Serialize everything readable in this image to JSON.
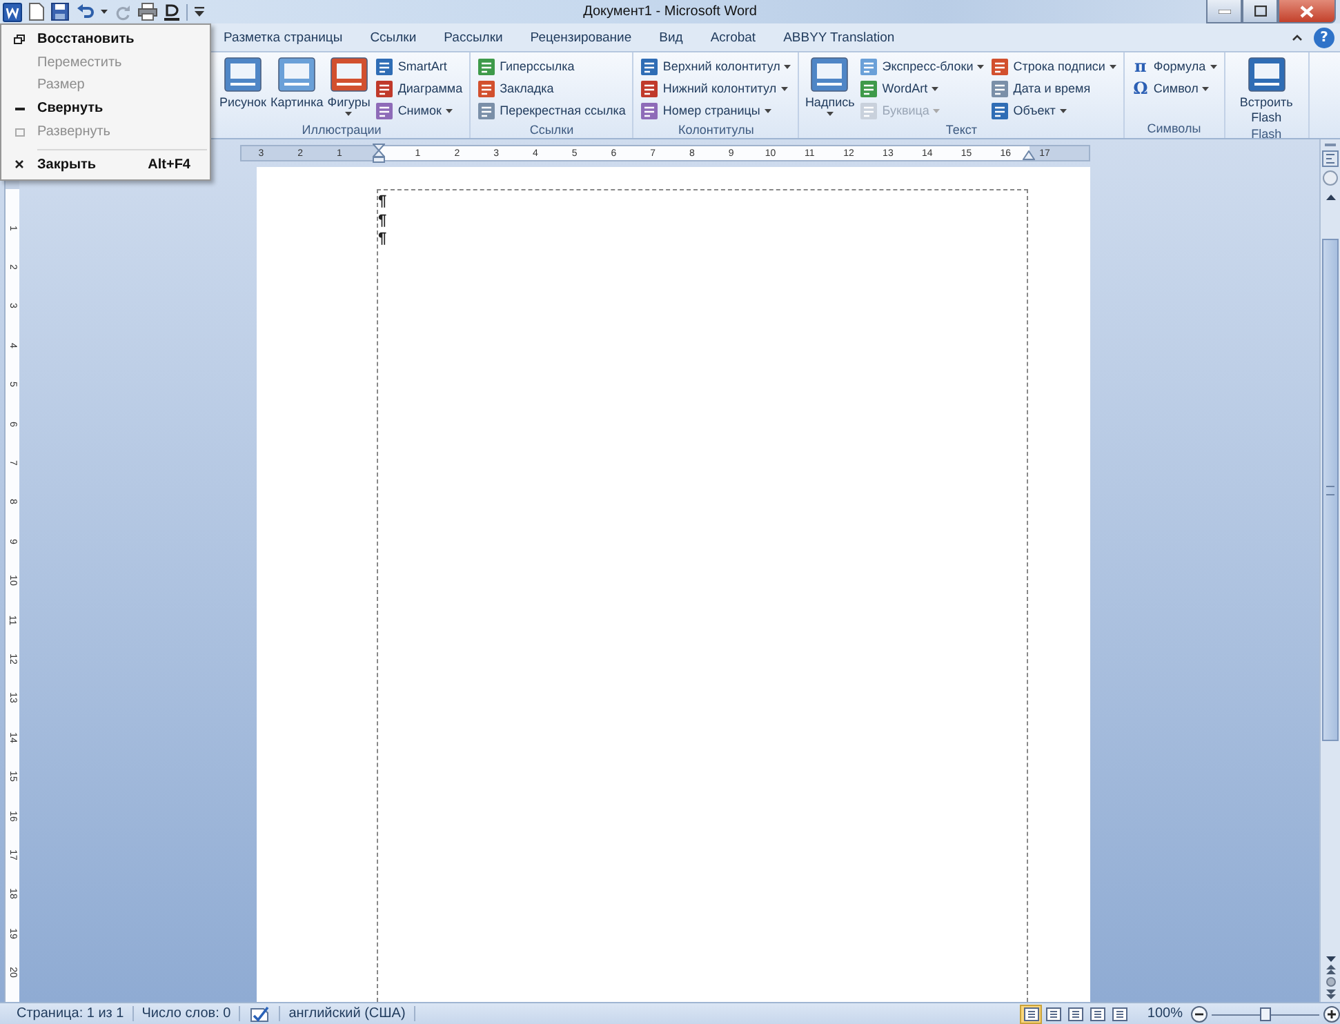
{
  "title_bar": {
    "title": "Документ1 - Microsoft Word"
  },
  "system_menu": {
    "items": [
      {
        "label": "Восстановить",
        "kind": "restore",
        "disabled": false,
        "separator_before": false
      },
      {
        "label": "Переместить",
        "kind": "move",
        "disabled": true,
        "separator_before": false
      },
      {
        "label": "Размер",
        "kind": "size",
        "disabled": true,
        "separator_before": false
      },
      {
        "label": "Свернуть",
        "kind": "minimize",
        "disabled": false,
        "separator_before": false
      },
      {
        "label": "Развернуть",
        "kind": "maximize",
        "disabled": true,
        "separator_before": false
      },
      {
        "label": "Закрыть",
        "kind": "close",
        "disabled": false,
        "separator_before": true,
        "shortcut": "Alt+F4"
      }
    ]
  },
  "tabs": [
    {
      "label": "Разметка страницы",
      "selected": false
    },
    {
      "label": "Ссылки",
      "selected": false
    },
    {
      "label": "Рассылки",
      "selected": false
    },
    {
      "label": "Рецензирование",
      "selected": false
    },
    {
      "label": "Вид",
      "selected": false
    },
    {
      "label": "Acrobat",
      "selected": false
    },
    {
      "label": "ABBYY Translation",
      "selected": false
    }
  ],
  "help": "?",
  "ribbon_groups": [
    {
      "label": "Иллюстрации",
      "columns": [
        {
          "kind": "large",
          "buttons": [
            {
              "label": "Рисунок",
              "dropdown": false,
              "disabled": false
            }
          ]
        },
        {
          "kind": "large",
          "buttons": [
            {
              "label": "Картинка",
              "dropdown": false,
              "disabled": false
            }
          ]
        },
        {
          "kind": "large",
          "buttons": [
            {
              "label": "Фигуры",
              "dropdown": true,
              "disabled": false
            }
          ]
        },
        {
          "kind": "small",
          "buttons": [
            {
              "label": "SmartArt",
              "dropdown": false,
              "disabled": false
            },
            {
              "label": "Диаграмма",
              "dropdown": false,
              "disabled": false
            },
            {
              "label": "Снимок",
              "dropdown": true,
              "disabled": false
            }
          ]
        }
      ]
    },
    {
      "label": "Ссылки",
      "columns": [
        {
          "kind": "small",
          "buttons": [
            {
              "label": "Гиперссылка",
              "dropdown": false,
              "disabled": false
            },
            {
              "label": "Закладка",
              "dropdown": false,
              "disabled": false
            },
            {
              "label": "Перекрестная ссылка",
              "dropdown": false,
              "disabled": false
            }
          ]
        }
      ]
    },
    {
      "label": "Колонтитулы",
      "columns": [
        {
          "kind": "small",
          "buttons": [
            {
              "label": "Верхний колонтитул",
              "dropdown": true,
              "disabled": false
            },
            {
              "label": "Нижний колонтитул",
              "dropdown": true,
              "disabled": false
            },
            {
              "label": "Номер страницы",
              "dropdown": true,
              "disabled": false
            }
          ]
        }
      ]
    },
    {
      "label": "Текст",
      "columns": [
        {
          "kind": "large",
          "buttons": [
            {
              "label": "Надпись",
              "dropdown": true,
              "disabled": false
            }
          ]
        },
        {
          "kind": "small",
          "buttons": [
            {
              "label": "Экспресс-блоки",
              "dropdown": true,
              "disabled": false
            },
            {
              "label": "WordArt",
              "dropdown": true,
              "disabled": false
            },
            {
              "label": "Буквица",
              "dropdown": true,
              "disabled": true
            }
          ]
        },
        {
          "kind": "small",
          "buttons": [
            {
              "label": "Строка подписи",
              "dropdown": true,
              "disabled": false
            },
            {
              "label": "Дата и время",
              "dropdown": false,
              "disabled": false
            },
            {
              "label": "Объект",
              "dropdown": true,
              "disabled": false
            }
          ]
        }
      ]
    },
    {
      "label": "Символы",
      "columns": [
        {
          "kind": "small",
          "buttons": [
            {
              "label": "Формула",
              "symbol": "π",
              "dropdown": true,
              "disabled": false
            },
            {
              "label": "Символ",
              "symbol": "Ω",
              "dropdown": true,
              "disabled": false
            }
          ]
        }
      ]
    },
    {
      "label": "Flash",
      "columns": [
        {
          "kind": "large",
          "buttons": [
            {
              "label": "Встроить Flash",
              "dropdown": false,
              "disabled": false
            }
          ]
        }
      ]
    }
  ],
  "horizontal_ruler": {
    "left_labels": [
      "3",
      "2",
      "1"
    ],
    "right_labels": [
      "1",
      "2",
      "3",
      "4",
      "5",
      "6",
      "7",
      "8",
      "9",
      "10",
      "11",
      "12",
      "13",
      "14",
      "15",
      "16",
      "17"
    ]
  },
  "vertical_ruler": {
    "labels": [
      "1",
      "2",
      "3",
      "4",
      "5",
      "6",
      "7",
      "8",
      "9",
      "10",
      "11",
      "12",
      "13",
      "14",
      "15",
      "16",
      "17",
      "18",
      "19",
      "20"
    ]
  },
  "document": {
    "paragraph_marks": [
      "¶",
      "¶",
      "¶"
    ]
  },
  "status_bar": {
    "page": "Страница: 1 из 1",
    "words": "Число слов: 0",
    "language": "английский (США)",
    "view_buttons": [
      {
        "selected": true
      },
      {
        "selected": false
      },
      {
        "selected": false
      },
      {
        "selected": false
      },
      {
        "selected": false
      }
    ],
    "zoom": "100%",
    "zoom_slider": {
      "level": 0.5
    }
  }
}
